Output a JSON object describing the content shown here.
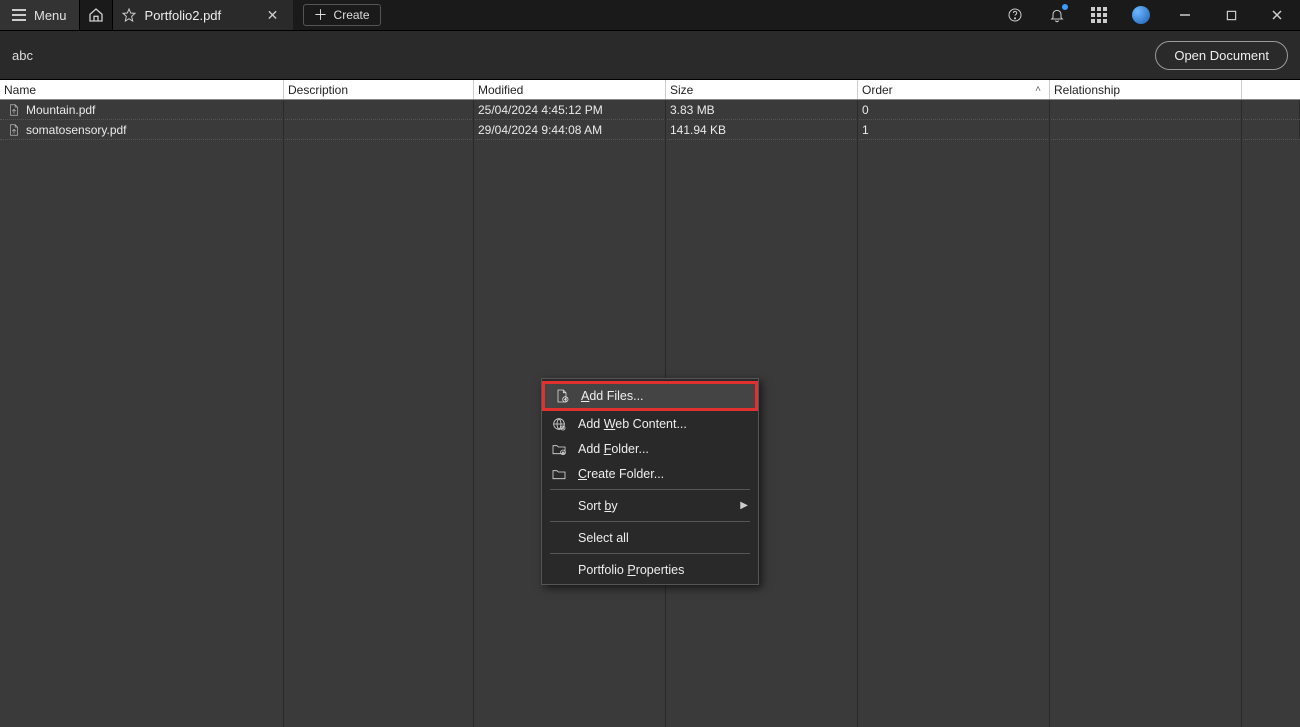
{
  "titlebar": {
    "menu_label": "Menu",
    "tab_title": "Portfolio2.pdf",
    "create_label": "Create"
  },
  "subheader": {
    "left_text": "abc",
    "open_document_label": "Open Document"
  },
  "columns": {
    "name": "Name",
    "description": "Description",
    "modified": "Modified",
    "size": "Size",
    "order": "Order",
    "relationship": "Relationship"
  },
  "rows": [
    {
      "name": "Mountain.pdf",
      "description": "",
      "modified": "25/04/2024 4:45:12 PM",
      "size": "3.83 MB",
      "order": "0",
      "relationship": ""
    },
    {
      "name": "somatosensory.pdf",
      "description": "",
      "modified": "29/04/2024 9:44:08 AM",
      "size": "141.94 KB",
      "order": "1",
      "relationship": ""
    }
  ],
  "context_menu": {
    "add_files": "Add Files...",
    "add_web_content": "Add Web Content...",
    "add_folder": "Add Folder...",
    "create_folder": "Create Folder...",
    "sort_by": "Sort by",
    "select_all": "Select all",
    "portfolio_properties": "Portfolio Properties"
  }
}
